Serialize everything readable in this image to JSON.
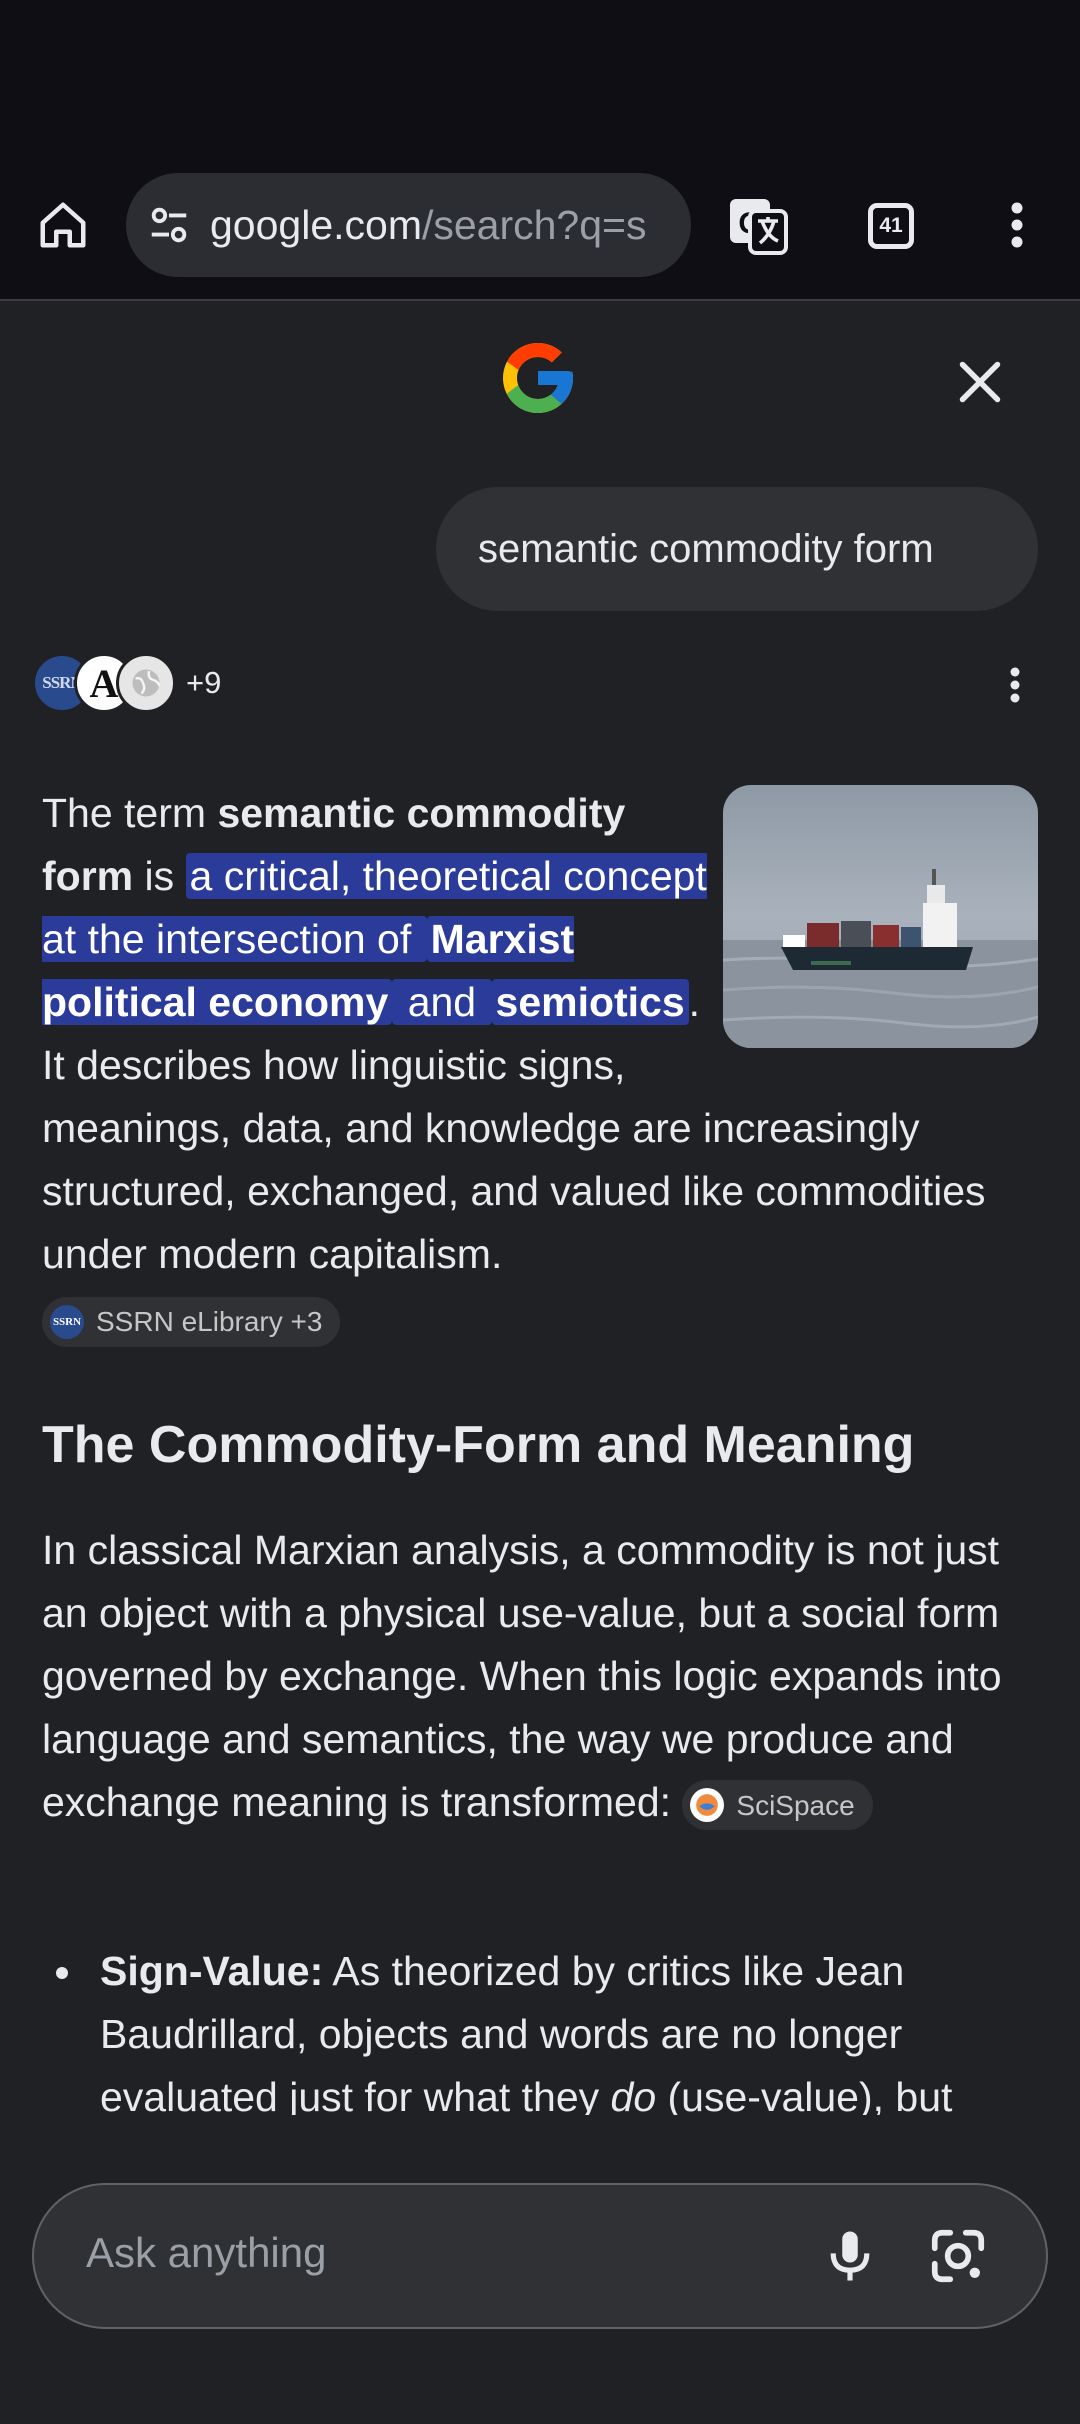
{
  "browser": {
    "url_domain": "google.com",
    "url_path": "/search?q=s",
    "tab_count": "41"
  },
  "query": "semantic commodity form",
  "sources": {
    "avatar_1": "SSRN",
    "avatar_2": "A",
    "more_count": "+9"
  },
  "answer": {
    "p1_a": "The term ",
    "p1_b": "semantic commodity form",
    "p1_c": " is ",
    "p1_hl1": "a critical, theoretical concept at the intersection of ",
    "p1_hl2": "Marxist political economy",
    "p1_hl3": " and ",
    "p1_hl4": "semiotics",
    "p1_d": ". It describes how linguistic signs, meanings, data, and knowledge are increasingly structured, exchanged, and valued like commodities under modern capitalism.",
    "citation_1": "SSRN eLibrary +3",
    "citation_1_icon": "SSRN"
  },
  "section": {
    "heading": "The Commodity-Form and Meaning",
    "para": "In classical Marxian analysis, a commodity is not just an object with a physical use-value, but a social form governed by exchange. When this logic expands into language and semantics, the way we produce and exchange meaning is transformed: ",
    "citation_2": "SciSpace"
  },
  "bullet": {
    "term": "Sign-Value:",
    "text_a": " As theorized by critics like Jean Baudrillard, objects and words are no longer evaluated just for what they ",
    "text_em": "do",
    "text_b": " (use-value), but"
  },
  "input": {
    "placeholder": "Ask anything"
  },
  "icons": {
    "home": "home-icon",
    "site_settings": "tune-icon",
    "translate": "translate-icon",
    "tabs": "tab-switcher-icon",
    "menu": "more-vert-icon",
    "close": "close-icon",
    "mic": "mic-icon",
    "lens": "lens-icon"
  }
}
